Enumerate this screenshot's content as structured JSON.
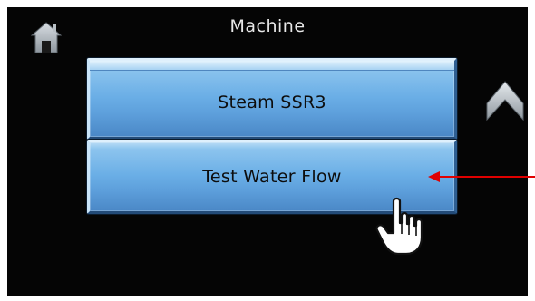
{
  "screen": {
    "title": "Machine"
  },
  "icons": {
    "home": "home-icon",
    "up": "chevron-up-icon",
    "pointer": "hand-pointer-icon",
    "annotation": "arrow-left-icon"
  },
  "menu": {
    "items": [
      {
        "label": "Steam SSR3"
      },
      {
        "label": "Test Water Flow"
      }
    ]
  },
  "colors": {
    "screen_background": "#050505",
    "button_blue": "#6aaee6",
    "title_text": "#e8e8e8",
    "annotation_arrow": "#e00000"
  }
}
